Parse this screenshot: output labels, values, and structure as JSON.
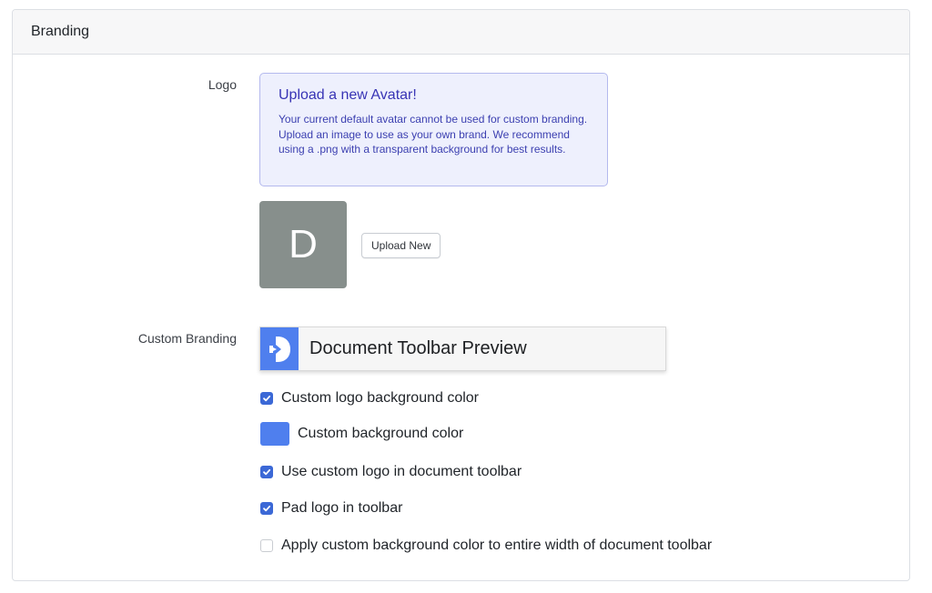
{
  "panel": {
    "title": "Branding"
  },
  "logo_section": {
    "label": "Logo",
    "notice": {
      "title": "Upload a new Avatar!",
      "body": "Your current default avatar cannot be used for custom branding. Upload an image to use as your own brand. We recommend using a .png with a transparent background for best results."
    },
    "avatar_letter": "D",
    "upload_button": "Upload New"
  },
  "custom_branding": {
    "label": "Custom Branding",
    "preview_title": "Document Toolbar Preview",
    "options": {
      "logo_bg": {
        "label": "Custom logo background color",
        "checked": true
      },
      "bg_color": {
        "label": "Custom background color",
        "color": "#4f7fee"
      },
      "use_logo": {
        "label": "Use custom logo in document toolbar",
        "checked": true
      },
      "pad_logo": {
        "label": "Pad logo in toolbar",
        "checked": true
      },
      "full_width": {
        "label": "Apply custom background color to entire width of document toolbar",
        "checked": false
      }
    }
  },
  "colors": {
    "accent": "#3b68d6",
    "brand_blue": "#4f7fee",
    "avatar_gray": "#878f8c"
  }
}
